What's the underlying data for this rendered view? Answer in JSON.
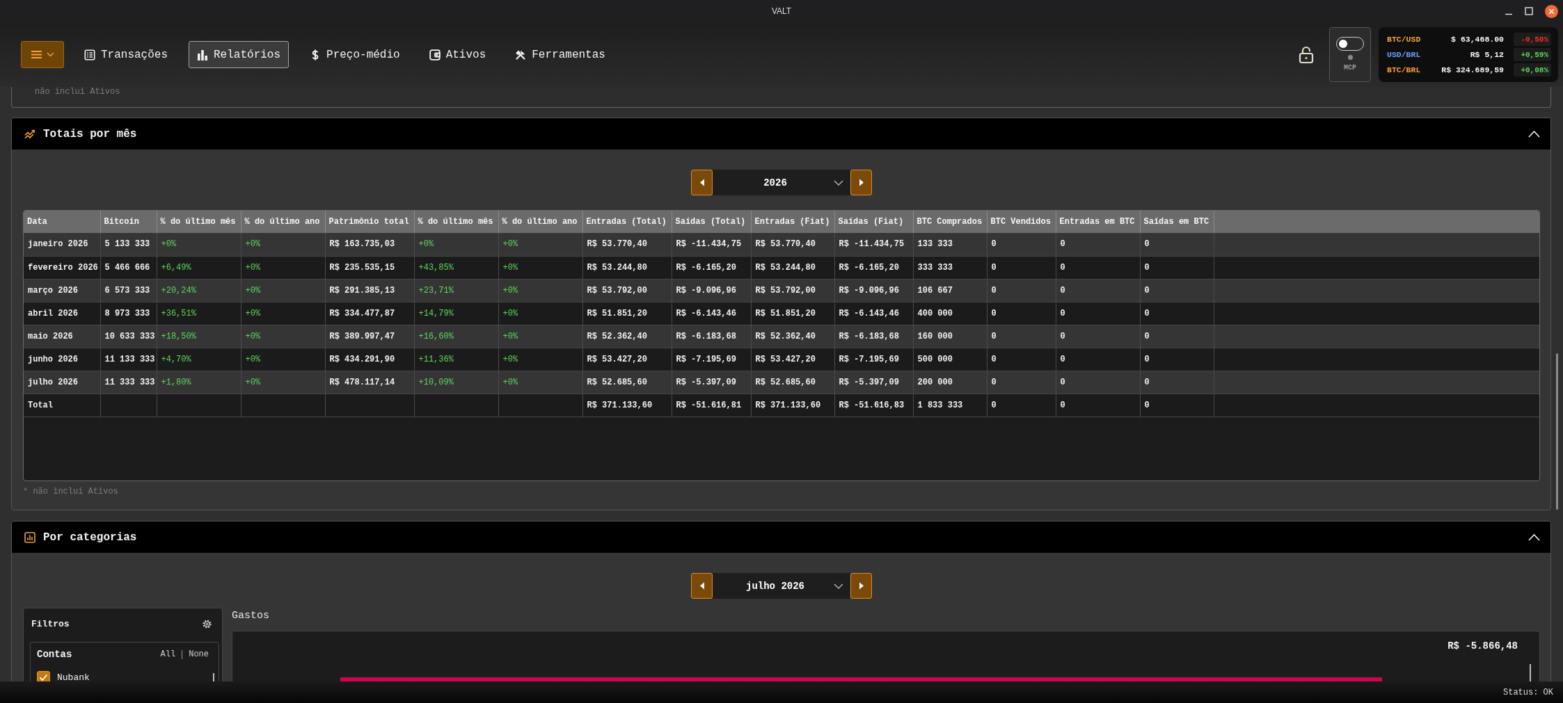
{
  "window": {
    "title": "VALT"
  },
  "nav": {
    "tabs": [
      {
        "label": "Transações",
        "kind": "list",
        "selected": false
      },
      {
        "label": "Relatórios",
        "kind": "chart",
        "selected": true
      },
      {
        "label": "Preço-médio",
        "kind": "dollar",
        "selected": false
      },
      {
        "label": "Ativos",
        "kind": "wallet",
        "selected": false
      },
      {
        "label": "Ferramentas",
        "kind": "tools",
        "selected": false
      }
    ]
  },
  "lock": {
    "locked": false
  },
  "mcp": {
    "label": "MCP",
    "on": false
  },
  "ticker": [
    {
      "pair": "BTC/USD",
      "color": "#f2a13c",
      "price": "$ 63,468.00",
      "change": "-0,50%",
      "negative": true
    },
    {
      "pair": "USD/BRL",
      "color": "#6d9ef2",
      "price": "R$ 5,12",
      "change": "+0,59%",
      "negative": false
    },
    {
      "pair": "BTC/BRL",
      "color": "#f2a13c",
      "price": "R$ 324.689,59",
      "change": "+0,08%",
      "negative": false
    }
  ],
  "previous_section": {
    "footnote": "não inclui Ativos"
  },
  "monthly_totals": {
    "title": "Totais por mês",
    "expanded": true,
    "year_picker": {
      "value": "2026"
    },
    "table": {
      "columns": [
        {
          "label": "Data",
          "kind": "text"
        },
        {
          "label": "Bitcoin",
          "kind": "text"
        },
        {
          "label": "% do último mês",
          "kind": "percent"
        },
        {
          "label": "% do último ano",
          "kind": "percent"
        },
        {
          "label": "Patrimônio total",
          "kind": "text"
        },
        {
          "label": "% do último mês",
          "kind": "percent"
        },
        {
          "label": "% do último ano",
          "kind": "percent"
        },
        {
          "label": "Entradas (Total)",
          "kind": "text"
        },
        {
          "label": "Saídas (Total)",
          "kind": "text"
        },
        {
          "label": "Entradas (Fiat)",
          "kind": "text"
        },
        {
          "label": "Saídas (Fiat)",
          "kind": "text"
        },
        {
          "label": "BTC Comprados",
          "kind": "text"
        },
        {
          "label": "BTC Vendidos",
          "kind": "text"
        },
        {
          "label": "Entradas em BTC",
          "kind": "text"
        },
        {
          "label": "Saídas em BTC",
          "kind": "text"
        }
      ],
      "rows": [
        {
          "cells": [
            "janeiro 2026",
            "5 133 333",
            "+0%",
            "+0%",
            "R$ 163.735,03",
            "+0%",
            "+0%",
            "R$ 53.770,40",
            "R$ -11.434,75",
            "R$ 53.770,40",
            "R$ -11.434,75",
            "133 333",
            "0",
            "0",
            "0"
          ]
        },
        {
          "cells": [
            "fevereiro 2026",
            "5 466 666",
            "+6,49%",
            "+0%",
            "R$ 235.535,15",
            "+43,85%",
            "+0%",
            "R$ 53.244,80",
            "R$ -6.165,20",
            "R$ 53.244,80",
            "R$ -6.165,20",
            "333 333",
            "0",
            "0",
            "0"
          ]
        },
        {
          "cells": [
            "março 2026",
            "6 573 333",
            "+20,24%",
            "+0%",
            "R$ 291.385,13",
            "+23,71%",
            "+0%",
            "R$ 53.792,00",
            "R$ -9.096,96",
            "R$ 53.792,00",
            "R$ -9.096,96",
            "106 667",
            "0",
            "0",
            "0"
          ]
        },
        {
          "cells": [
            "abril 2026",
            "8 973 333",
            "+36,51%",
            "+0%",
            "R$ 334.477,87",
            "+14,79%",
            "+0%",
            "R$ 51.851,20",
            "R$ -6.143,46",
            "R$ 51.851,20",
            "R$ -6.143,46",
            "400 000",
            "0",
            "0",
            "0"
          ]
        },
        {
          "cells": [
            "maio 2026",
            "10 633 333",
            "+18,50%",
            "+0%",
            "R$ 389.997,47",
            "+16,60%",
            "+0%",
            "R$ 52.362,40",
            "R$ -6.183,68",
            "R$ 52.362,40",
            "R$ -6.183,68",
            "160 000",
            "0",
            "0",
            "0"
          ]
        },
        {
          "cells": [
            "junho 2026",
            "11 133 333",
            "+4,70%",
            "+0%",
            "R$ 434.291,90",
            "+11,36%",
            "+0%",
            "R$ 53.427,20",
            "R$ -7.195,69",
            "R$ 53.427,20",
            "R$ -7.195,69",
            "500 000",
            "0",
            "0",
            "0"
          ]
        },
        {
          "cells": [
            "julho 2026",
            "11 333 333",
            "+1,80%",
            "+0%",
            "R$ 478.117,14",
            "+10,09%",
            "+0%",
            "R$ 52.685,60",
            "R$ -5.397,09",
            "R$ 52.685,60",
            "R$ -5.397,09",
            "200 000",
            "0",
            "0",
            "0"
          ]
        },
        {
          "cells": [
            "Total",
            null,
            null,
            null,
            null,
            null,
            null,
            "R$ 371.133,60",
            "R$ -51.616,81",
            "R$ 371.133,60",
            "R$ -51.616,83",
            "1 833 333",
            "0",
            "0",
            "0"
          ]
        }
      ]
    },
    "footnote": "* não inclui Ativos"
  },
  "by_category": {
    "title": "Por categorias",
    "expanded": true,
    "month_picker": {
      "value": "julho 2026"
    },
    "filters": {
      "title": "Filtros",
      "groups": [
        {
          "title": "Contas",
          "all": "All",
          "none": "None",
          "items": [
            {
              "label": "Nubank",
              "checked": true
            }
          ]
        }
      ]
    },
    "expenses": {
      "title": "Gastos",
      "total": "R$ -5.866,48"
    }
  },
  "status_bar": {
    "text": "Status: OK"
  }
}
